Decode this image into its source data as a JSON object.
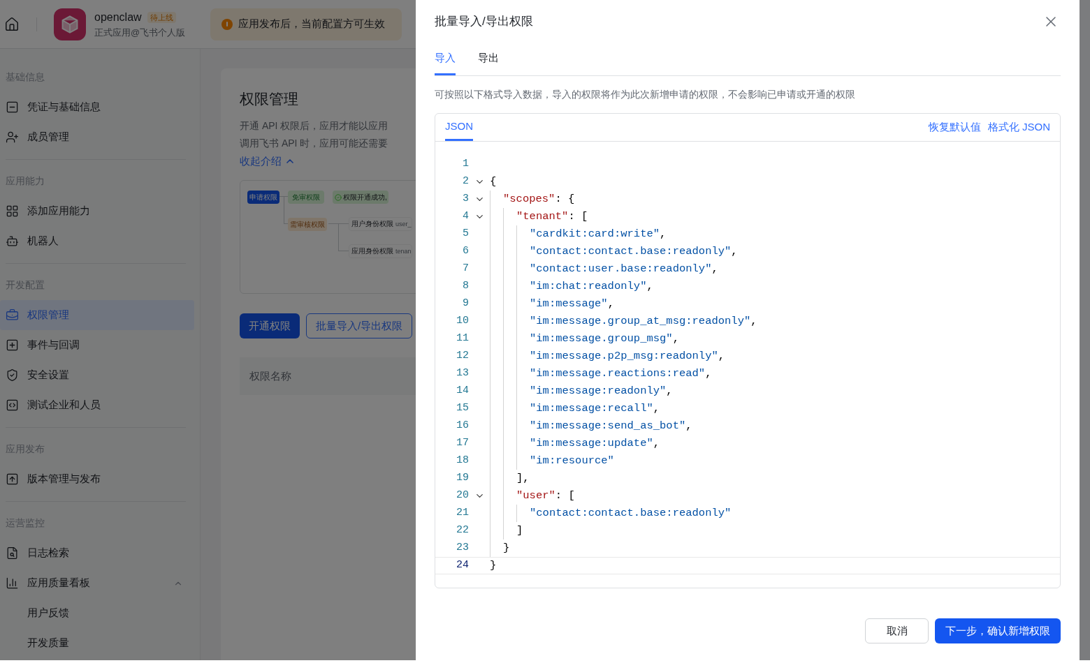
{
  "header": {
    "app_name": "openclaw",
    "app_status": "待上线",
    "app_subtitle": "正式应用@飞书个人版",
    "notice": "应用发布后，当前配置方可生效"
  },
  "sidebar": {
    "sections": [
      {
        "title": "基础信息",
        "items": [
          {
            "label": "凭证与基础信息",
            "selected": false
          },
          {
            "label": "成员管理",
            "selected": false
          }
        ]
      },
      {
        "title": "应用能力",
        "items": [
          {
            "label": "添加应用能力",
            "selected": false
          },
          {
            "label": "机器人",
            "selected": false
          }
        ]
      },
      {
        "title": "开发配置",
        "items": [
          {
            "label": "权限管理",
            "selected": true
          },
          {
            "label": "事件与回调",
            "selected": false
          },
          {
            "label": "安全设置",
            "selected": false
          },
          {
            "label": "测试企业和人员",
            "selected": false
          }
        ]
      },
      {
        "title": "应用发布",
        "items": [
          {
            "label": "版本管理与发布",
            "selected": false
          }
        ]
      },
      {
        "title": "运营监控",
        "items": [
          {
            "label": "日志检索",
            "selected": false
          },
          {
            "label": "应用质量看板",
            "selected": false,
            "expanded": true,
            "children": [
              {
                "label": "用户反馈",
                "selected": false
              },
              {
                "label": "开发质量",
                "selected": false
              }
            ]
          }
        ]
      }
    ]
  },
  "main": {
    "title": "权限管理",
    "intro_lines": [
      "开通 API 权限后，应用才能以应用",
      "调用飞书 API 时，应用可能还需要"
    ],
    "collapse_link": "收起介绍",
    "diagram": {
      "apply": "申请权限",
      "free": "免审权限",
      "success": "权限开通成功,",
      "review": "需审核权限",
      "user": "用户身份权限",
      "user_hint": "user_",
      "tenant": "应用身份权限",
      "tenant_hint": "tenan"
    },
    "buttons": [
      {
        "label": "开通权限",
        "kind": "primary"
      },
      {
        "label": "批量导入/导出权限",
        "kind": "outline"
      }
    ],
    "table": {
      "columns": [
        "权限名称"
      ]
    }
  },
  "drawer": {
    "title": "批量导入/导出权限",
    "tabs": [
      {
        "label": "导入",
        "selected": true
      },
      {
        "label": "导出",
        "selected": false
      }
    ],
    "description": "可按照以下格式导入数据，导入的权限将作为此次新增申请的权限，不会影响已申请或开通的权限",
    "editor": {
      "tabs": [
        {
          "label": "JSON",
          "selected": true
        }
      ],
      "actions": [
        "恢复默认值",
        "格式化 JSON"
      ],
      "lines": [
        {
          "number": "1",
          "foldable": false,
          "selected": false
        },
        {
          "number": "2",
          "text": "{",
          "foldable": true,
          "selected": false
        },
        {
          "number": "3",
          "text": "  \"scopes\": {",
          "foldable": true,
          "selected": false
        },
        {
          "number": "4",
          "text": "    \"tenant\": [",
          "foldable": true,
          "selected": false
        },
        {
          "number": "5",
          "text": "      \"cardkit:card:write\",",
          "foldable": false,
          "selected": false
        },
        {
          "number": "6",
          "text": "      \"contact:contact.base:readonly\",",
          "foldable": false,
          "selected": false
        },
        {
          "number": "7",
          "text": "      \"contact:user.base:readonly\",",
          "foldable": false,
          "selected": false
        },
        {
          "number": "8",
          "text": "      \"im:chat:readonly\",",
          "foldable": false,
          "selected": false
        },
        {
          "number": "9",
          "text": "      \"im:message\",",
          "foldable": false,
          "selected": false
        },
        {
          "number": "10",
          "text": "      \"im:message.group_at_msg:readonly\",",
          "foldable": false,
          "selected": false
        },
        {
          "number": "11",
          "text": "      \"im:message.group_msg\",",
          "foldable": false,
          "selected": false
        },
        {
          "number": "12",
          "text": "      \"im:message.p2p_msg:readonly\",",
          "foldable": false,
          "selected": false
        },
        {
          "number": "13",
          "text": "      \"im:message.reactions:read\",",
          "foldable": false,
          "selected": false
        },
        {
          "number": "14",
          "text": "      \"im:message:readonly\",",
          "foldable": false,
          "selected": false
        },
        {
          "number": "15",
          "text": "      \"im:message:recall\",",
          "foldable": false,
          "selected": false
        },
        {
          "number": "16",
          "text": "      \"im:message:send_as_bot\",",
          "foldable": false,
          "selected": false
        },
        {
          "number": "17",
          "text": "      \"im:message:update\",",
          "foldable": false,
          "selected": false
        },
        {
          "number": "18",
          "text": "      \"im:resource\"",
          "foldable": false,
          "selected": false
        },
        {
          "number": "19",
          "text": "    ],",
          "foldable": false,
          "selected": false
        },
        {
          "number": "20",
          "text": "    \"user\": [",
          "foldable": true,
          "selected": false
        },
        {
          "number": "21",
          "text": "      \"contact:contact.base:readonly\"",
          "foldable": false,
          "selected": false
        },
        {
          "number": "22",
          "text": "    ]",
          "foldable": false,
          "selected": false
        },
        {
          "number": "23",
          "text": "  }",
          "foldable": false,
          "selected": false
        },
        {
          "number": "24",
          "text": "}",
          "foldable": false,
          "selected": true
        }
      ]
    },
    "buttons": [
      {
        "label": "取消",
        "kind": "secondary"
      },
      {
        "label": "下一步，确认新增权限",
        "kind": "primary"
      }
    ]
  }
}
